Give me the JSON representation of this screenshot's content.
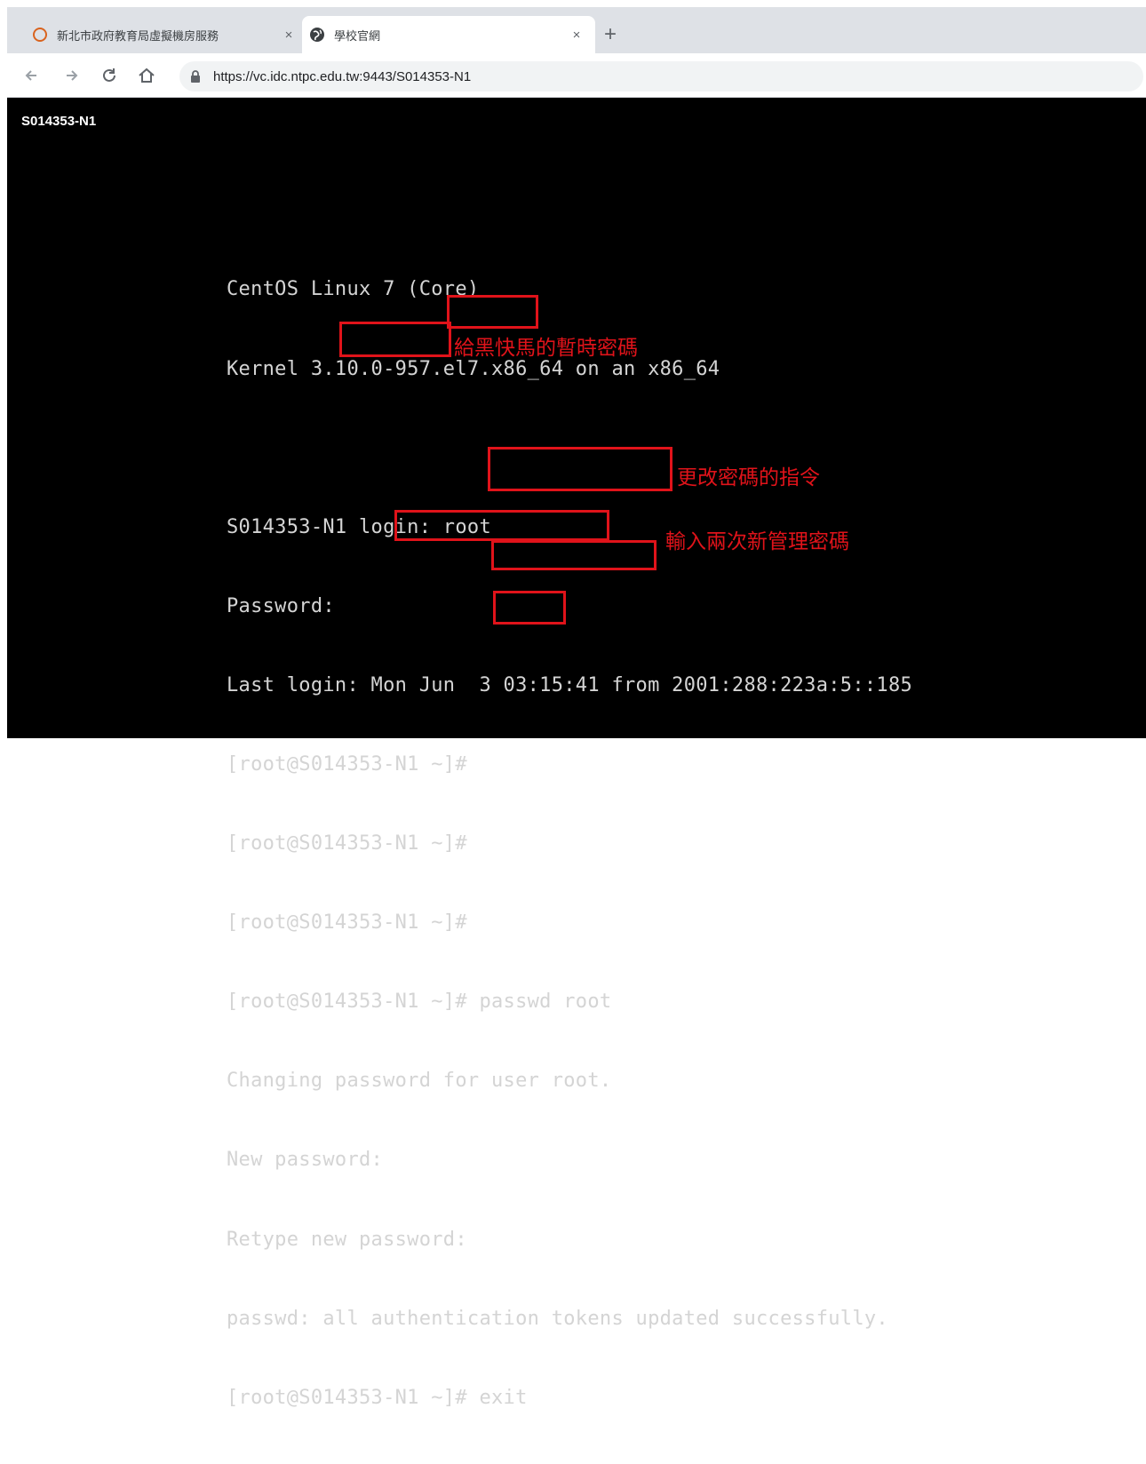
{
  "tabs": [
    {
      "title": "新北市政府教育局虛擬機房服務",
      "close": "×",
      "icon": "loading-circle-icon",
      "active": false
    },
    {
      "title": "學校官網",
      "close": "×",
      "icon": "globe-icon",
      "active": true
    }
  ],
  "new_tab_label": "+",
  "address_bar": {
    "url": "https://vc.idc.ntpc.edu.tw:9443/S014353-N1"
  },
  "console": {
    "vm_title": "S014353-N1",
    "lines": [
      "CentOS Linux 7 (Core)",
      "Kernel 3.10.0-957.el7.x86_64 on an x86_64",
      "",
      "S014353-N1 login: root",
      "Password:",
      "Last login: Mon Jun  3 03:15:41 from 2001:288:223a:5::185",
      "[root@S014353-N1 ~]#",
      "[root@S014353-N1 ~]#",
      "[root@S014353-N1 ~]#",
      "[root@S014353-N1 ~]# passwd root",
      "Changing password for user root.",
      "New password:",
      "Retype new password:",
      "passwd: all authentication tokens updated successfully.",
      "[root@S014353-N1 ~]# exit"
    ]
  },
  "annotations": {
    "temp_password": "給黑快馬的暫時密碼",
    "change_password_cmd": "更改密碼的指令",
    "enter_twice": "輸入兩次新管理密碼"
  },
  "colors": {
    "highlight_red": "#e0131a",
    "terminal_bg": "#000000",
    "terminal_text": "#d4d4d4",
    "tabstrip_bg": "#dee1e6"
  }
}
